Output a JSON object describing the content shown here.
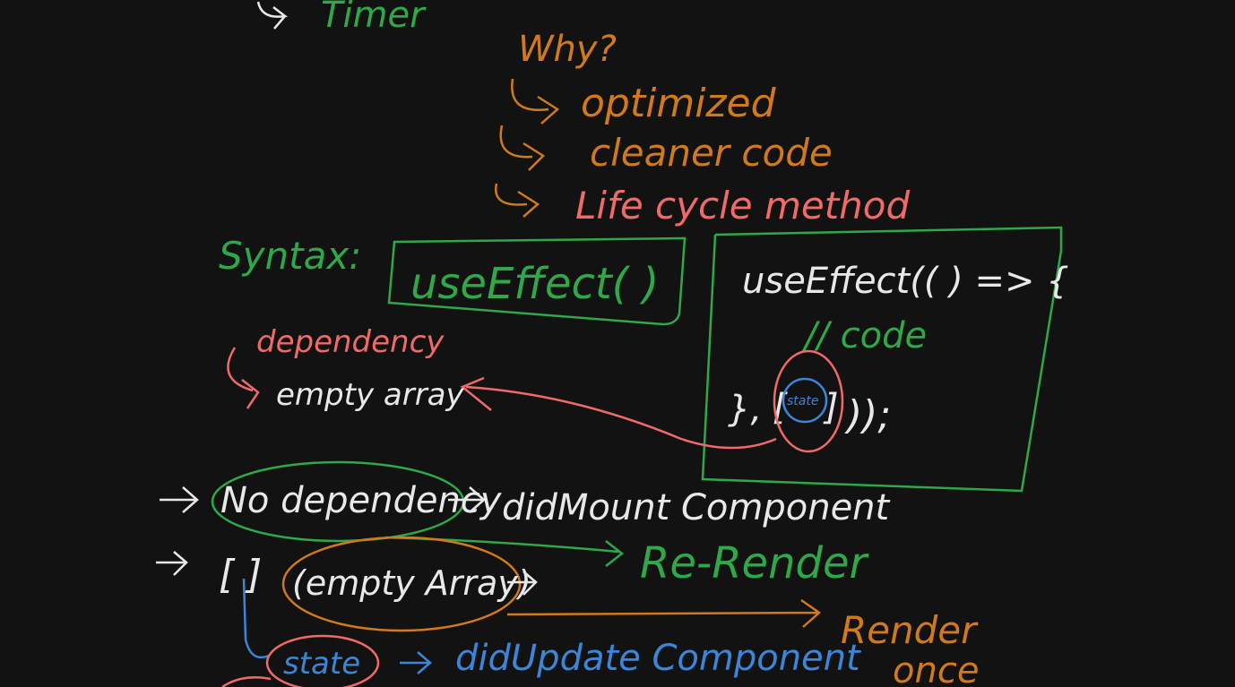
{
  "colors": {
    "background": "#121212",
    "white": "#e8e8e8",
    "green": "#2fa84a",
    "orange": "#d07a1c",
    "red": "#f06a6a",
    "blue": "#3b86d8"
  },
  "notes": {
    "timer": "Timer",
    "why": "Why?",
    "why_items": [
      "optimized",
      "cleaner code",
      "Life cycle method"
    ],
    "syntax_label": "Syntax:",
    "syntax_code": "useEffect( )",
    "code_line1": "useEffect(( ) => {",
    "code_comment": "// code",
    "code_close_prefix": "}, ",
    "code_close_suffix": "));",
    "deps_badge": "state",
    "dependency_label": "dependency",
    "empty_array": "empty array",
    "no_dependency": "No dependency",
    "did_mount": "didMount Component",
    "re_render": "Re-Render",
    "bracket_case": "[ ]",
    "empty_array_paren": "(empty Array)",
    "render_once_1": "Render",
    "render_once_2": "once",
    "state": "state",
    "did_update": "didUpdate Component"
  }
}
